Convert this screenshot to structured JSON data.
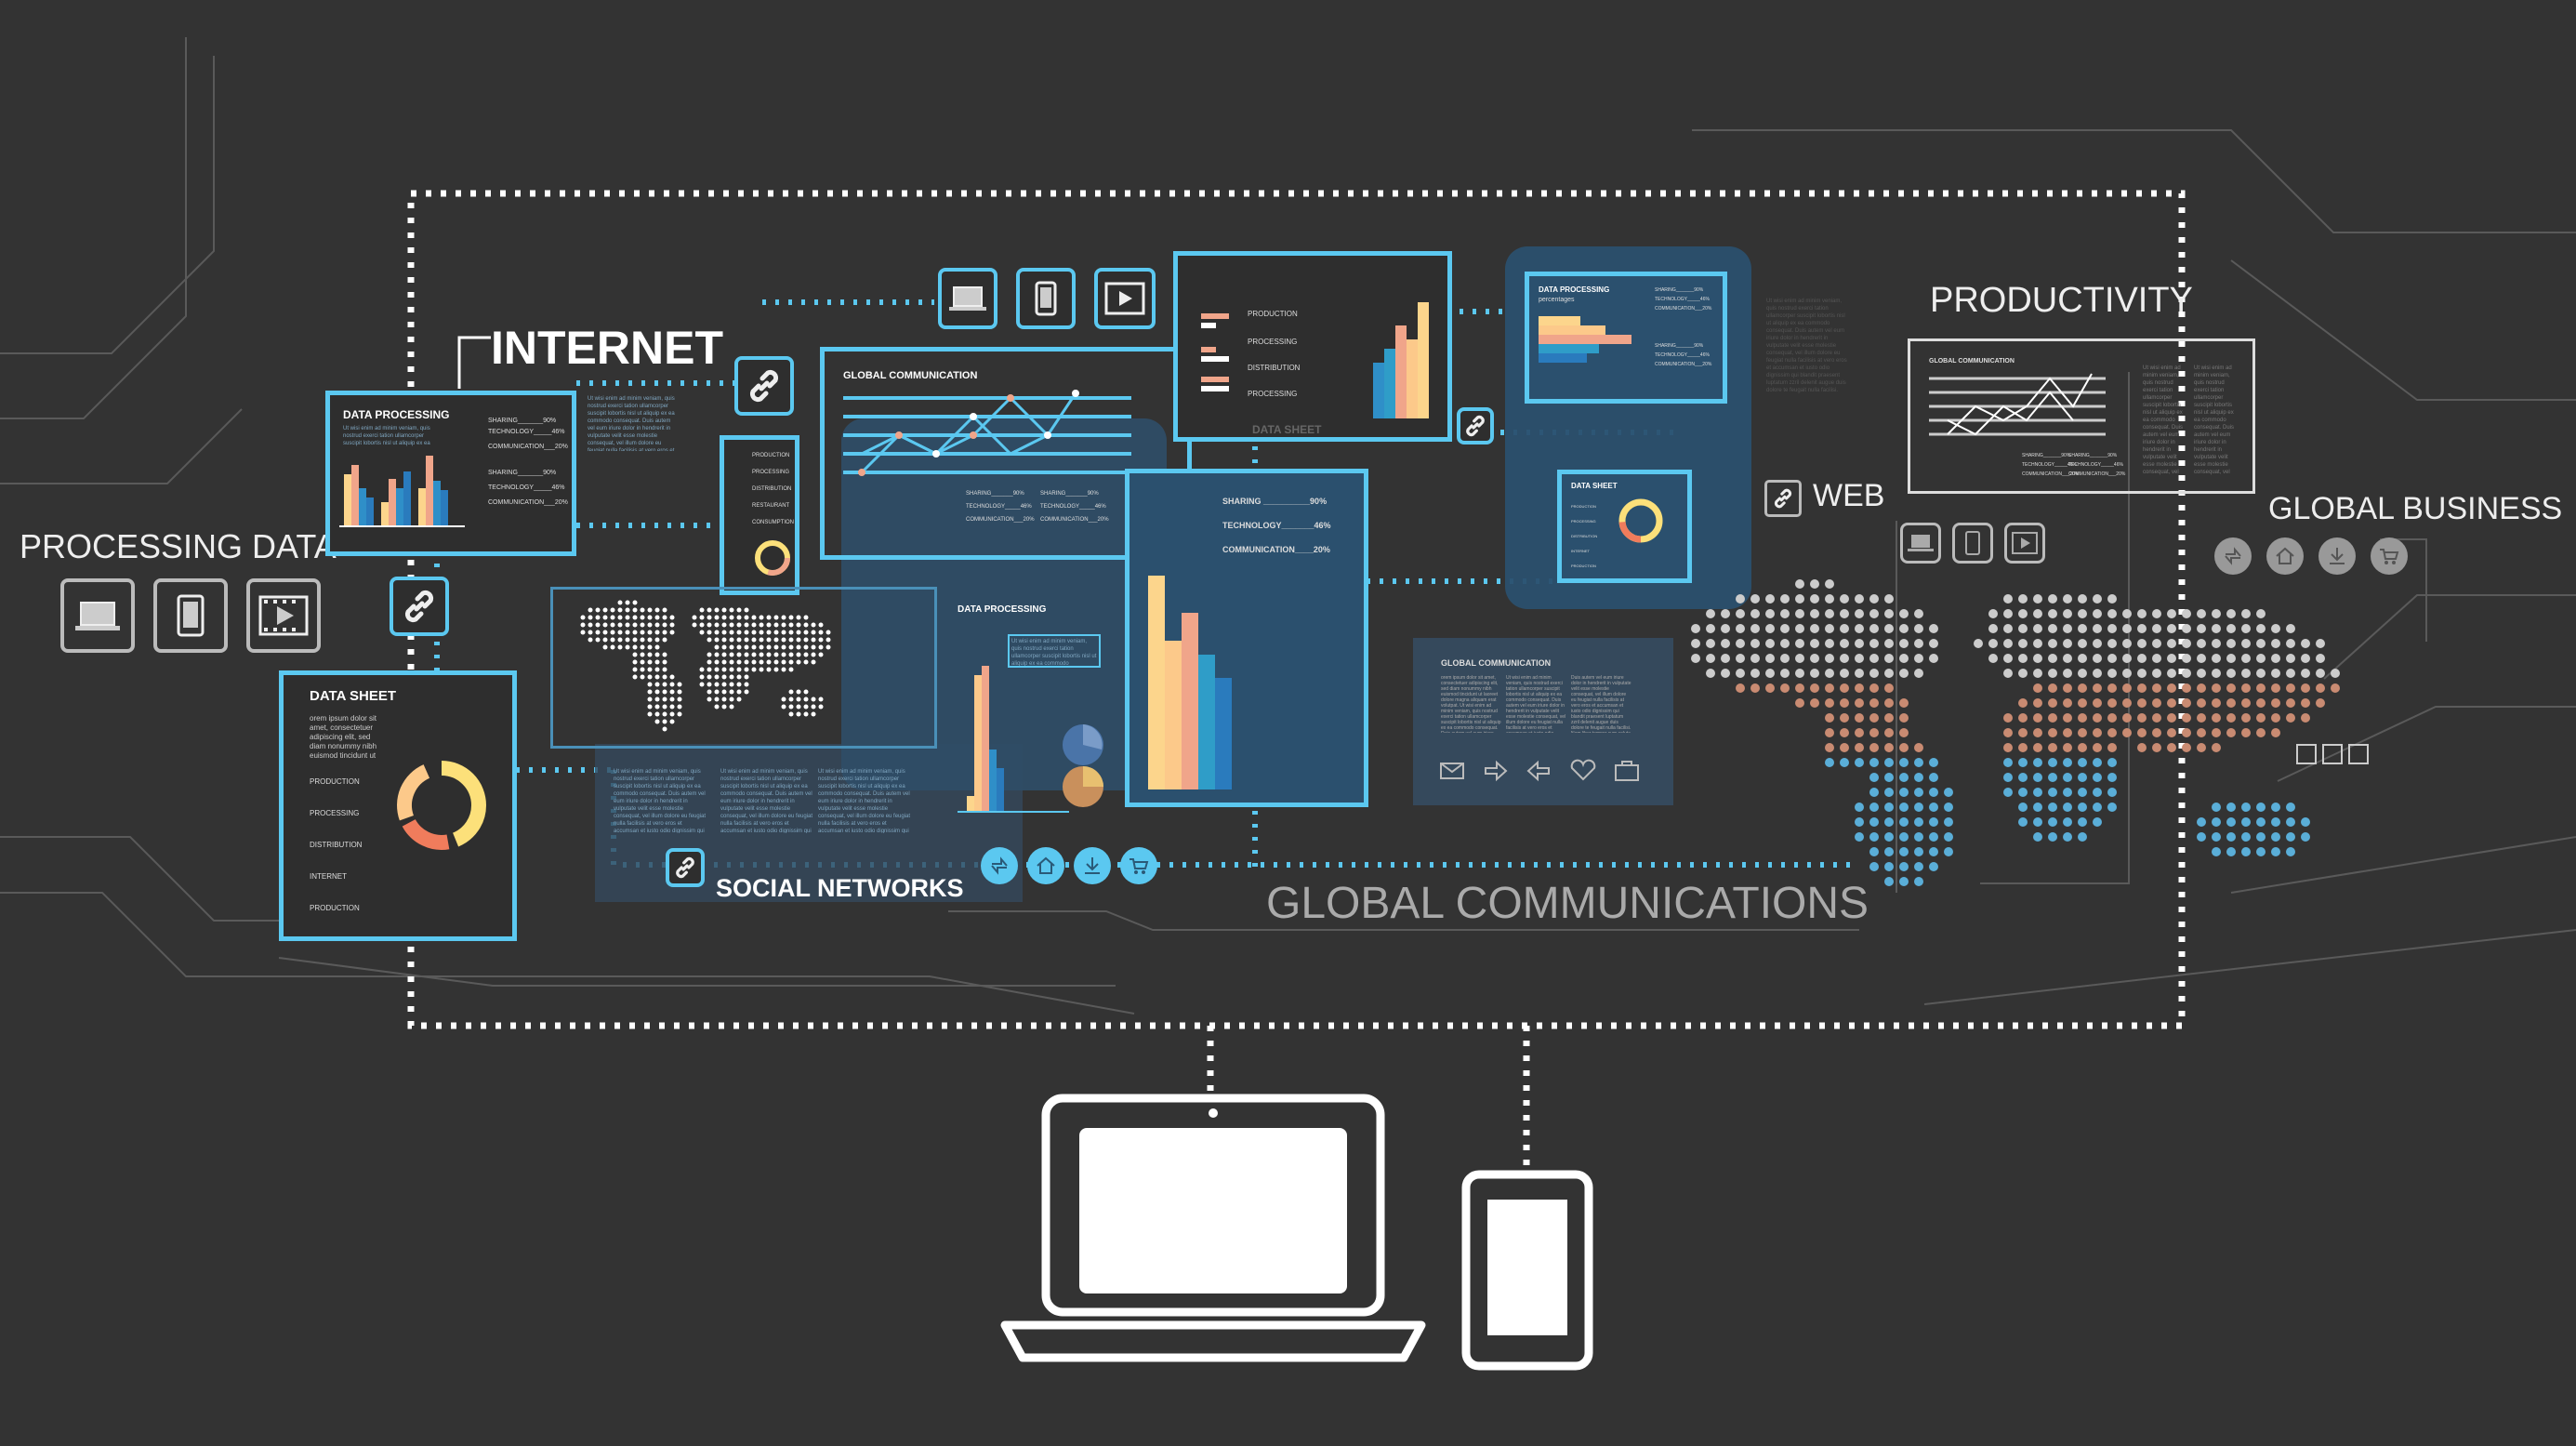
{
  "labels": {
    "internet": "INTERNET",
    "processing_data": "PROCESSING DATA",
    "productivity": "PRODUCTIVITY",
    "web": "WEB",
    "global_business": "GLOBAL BUSINESS",
    "social_networks": "SOCIAL NETWORKS",
    "global_communications": "GLOBAL COMMUNICATIONS"
  },
  "panels": {
    "data_processing_left": {
      "title": "DATA PROCESSING",
      "stats": [
        "SHARING_______90%",
        "TECHNOLOGY_____46%",
        "COMMUNICATION___20%",
        "SHARING_______90%",
        "TECHNOLOGY_____46%",
        "COMMUNICATION___20%"
      ]
    },
    "data_sheet_left": {
      "title": "DATA SHEET",
      "text": "orem ipsum dolor sit amet, consectetuer adipiscing elit, sed diam nonummy nibh euismod tincidunt ut",
      "items": [
        "PRODUCTION",
        "PROCESSING",
        "DISTRIBUTION",
        "INTERNET",
        "PRODUCTION"
      ]
    },
    "vertical_legend": {
      "items": [
        "PRODUCTION",
        "PROCESSING",
        "DISTRIBUTION",
        "RESTAURANT",
        "CONSUMPTION"
      ]
    },
    "global_communication_center": {
      "title": "GLOBAL COMMUNICATION",
      "stats_a": [
        "SHARING_______90%",
        "TECHNOLOGY_____46%",
        "COMMUNICATION___20%"
      ],
      "stats_b": [
        "SHARING_______90%",
        "TECHNOLOGY_____46%",
        "COMMUNICATION___20%"
      ]
    },
    "data_processing_middle": {
      "title": "DATA PROCESSING"
    },
    "sharing_panel": {
      "stats": [
        "SHARING __________90%",
        "TECHNOLOGY_______46%",
        "COMMUNICATION____20%"
      ]
    },
    "data_sheet_top": {
      "title": "DATA SHEET",
      "items": [
        "PRODUCTION",
        "PROCESSING",
        "DISTRIBUTION",
        "PROCESSING"
      ]
    },
    "data_processing_right": {
      "title": "DATA PROCESSING",
      "subtitle": "percentages",
      "stats": [
        "SHARING_______90%",
        "TECHNOLOGY_____46%",
        "COMMUNICATION___20%",
        "SHARING_______90%",
        "TECHNOLOGY_____46%",
        "COMMUNICATION___20%"
      ]
    },
    "data_sheet_right": {
      "title": "DATA SHEET",
      "items": [
        "PRODUCTION",
        "PROCESSING",
        "DISTRIBUTION",
        "INTERNET",
        "PRODUCTION"
      ]
    },
    "global_communication_text": {
      "title": "GLOBAL COMMUNICATION",
      "columns": [
        "orem ipsum dolor sit amet, consectetuer adipiscing elit, sed diam nonummy nibh euismod tincidunt ut laoreet dolore magna aliquam erat volutpat. Ut wisi enim ad minim veniam, quis nostrud exerci tation ullamcorper suscipit lobortis nisl ut aliquip ex ea commodo consequat. Duis autem vel eum iriure",
        "Ut wisi enim ad minim veniam, quis nostrud exerci tation ullamcorper suscipit lobortis nisl ut aliquip ex ea commodo consequat. Duis autem vel eum iriure dolor in hendrerit in vulputate velit esse molestie consequat, vel illum dolore eu feugiat nulla facilisis at vero eros et accumsan et iusto odio",
        "Duis autem vel eum iriure dolor in hendrerit in vulputate velit esse molestie consequat, vel illum dolore eu feugiat nulla facilisis at vero eros et accumsan et iusto odio dignissim qui blandit praesent luptatum zzril delenit augue duis dolore te feugait nulla facilisi. Nam liber tempor cum soluta nobis"
      ]
    },
    "productivity_chart": {
      "title": "GLOBAL COMMUNICATION",
      "stats_a": [
        "SHARING_______90%",
        "TECHNOLOGY_____46%",
        "COMMUNICATION___20%"
      ],
      "stats_b": [
        "SHARING_______90%",
        "TECHNOLOGY_____46%",
        "COMMUNICATION___20%"
      ]
    }
  },
  "lorem": "Ut wisi enim ad minim veniam, quis nostrud exerci tation ullamcorper suscipit lobortis nisl ut aliquip ex ea commodo consequat. Duis autem vel eum iriure dolor in hendrerit in vulputate velit esse molestie consequat, vel illum dolore eu feugiat nulla facilisis at vero eros et accumsan et iusto odio dignissim qui blandit praesent luptatum zzril delenit augue duis dolore te feugait nulla facilisi.",
  "icons": {
    "device_row": [
      "laptop-icon",
      "tablet-icon",
      "film-icon"
    ],
    "social_circles": [
      "exchange-icon",
      "home-icon",
      "download-icon",
      "cart-icon"
    ],
    "comm_icons": [
      "mail-icon",
      "arrow-right-icon",
      "arrow-left-icon",
      "heart-icon",
      "briefcase-icon"
    ]
  },
  "colors": {
    "background": "#333333",
    "accent": "#5bc8f0",
    "panel_blue": "#2b506e",
    "orange": "#f0a58a",
    "yellow": "#fcd58c",
    "blue": "#2f8fc8",
    "map_dot": "#cccccc",
    "map_orange": "#c98b72",
    "map_blue": "#5aaed8"
  }
}
